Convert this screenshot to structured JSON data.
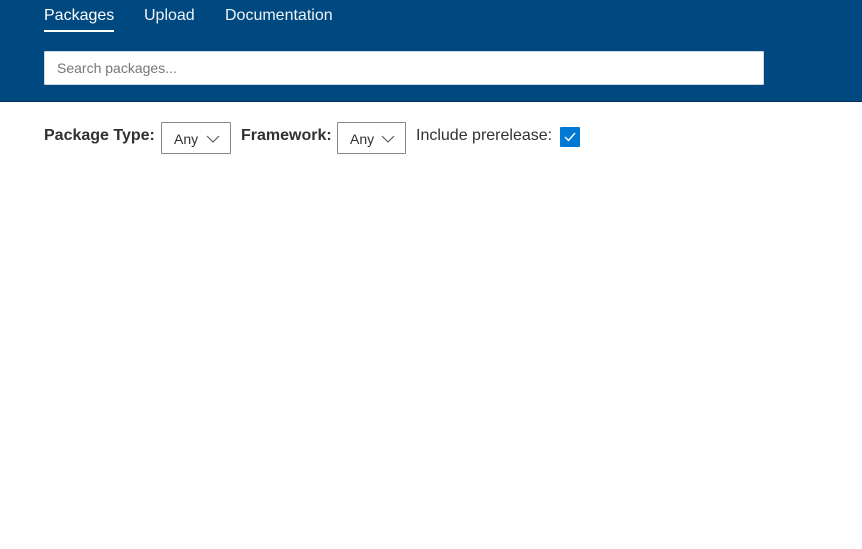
{
  "nav": {
    "links": [
      {
        "label": "Packages",
        "active": true
      },
      {
        "label": "Upload",
        "active": false
      },
      {
        "label": "Documentation",
        "active": false
      }
    ]
  },
  "search": {
    "placeholder": "Search packages...",
    "value": ""
  },
  "filters": {
    "package_type": {
      "label": "Package Type:",
      "value": "Any"
    },
    "framework": {
      "label": "Framework:",
      "value": "Any"
    },
    "prerelease": {
      "label": "Include prerelease:",
      "checked": true
    }
  },
  "colors": {
    "header_bg": "#004880",
    "checkbox_accent": "#0078d4"
  },
  "icons": {
    "dropdown": "chevron-down-icon",
    "checkbox": "checkmark-icon"
  }
}
